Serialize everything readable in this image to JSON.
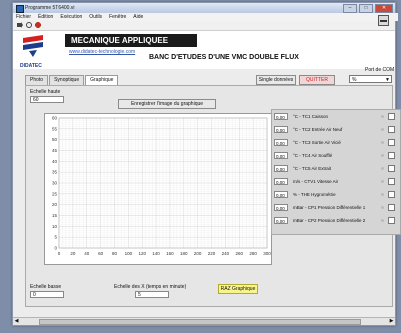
{
  "window": {
    "title": "Programme 5T6400.vi"
  },
  "menu": [
    "Fichier",
    "Édition",
    "Exécution",
    "Outils",
    "Fenêtre",
    "Aide"
  ],
  "header": {
    "logo_text": "DIDATEC",
    "banner": "MECANIQUE APPLIQUEE",
    "url": "www.didatec-technologie.com",
    "title": "BANC D'ETUDES D'UNE VMC DOUBLE FLUX"
  },
  "tabs": [
    {
      "label": "Photo",
      "active": false
    },
    {
      "label": "Synoptique",
      "active": false
    },
    {
      "label": "Graphique",
      "active": true
    }
  ],
  "buttons": {
    "single_data": "Single données",
    "quit": "QUITTER",
    "save_graph": "Enregistrer l'image du graphique",
    "raz": "RAZ Graphique"
  },
  "com_port": {
    "label": "Port de COM",
    "value": "%"
  },
  "fields": {
    "scale_high_label": "Echelle haute",
    "scale_high_value": "60",
    "scale_low_label": "Echelle basse",
    "scale_low_value": "0",
    "time_scale_label": "Echelle des X (temps en minute)",
    "time_scale_value": "5"
  },
  "chart_data": {
    "type": "line",
    "xlim": [
      0,
      300
    ],
    "ylim": [
      0,
      60
    ],
    "x_ticks": [
      "0",
      "20",
      "40",
      "60",
      "80",
      "100",
      "120",
      "140",
      "160",
      "180",
      "200",
      "220",
      "240",
      "260",
      "280",
      "300"
    ],
    "y_ticks": [
      "0",
      "5",
      "10",
      "15",
      "20",
      "25",
      "30",
      "35",
      "40",
      "45",
      "50",
      "55",
      "60"
    ],
    "grid": true,
    "series": []
  },
  "legend": [
    {
      "value": "0,00",
      "label": "°C - TC1 Caisson"
    },
    {
      "value": "0,00",
      "label": "°C - TC2 Entrée Air Neuf"
    },
    {
      "value": "0,00",
      "label": "°C - TC3 Sortie Air Vicié"
    },
    {
      "value": "0,00",
      "label": "°C - TC4 Air Soufflé"
    },
    {
      "value": "0,00",
      "label": "°C - TC5 Air Extrait"
    },
    {
      "value": "0,00",
      "label": "m/s - CTV1 Vitesse Air"
    },
    {
      "value": "0,00",
      "label": "% - THE Hygrométrie"
    },
    {
      "value": "0,00",
      "label": "mBar - CP1 Pression Différentielle 1"
    },
    {
      "value": "0,00",
      "label": "mBar - CP2 Pression Différentielle 2"
    }
  ]
}
